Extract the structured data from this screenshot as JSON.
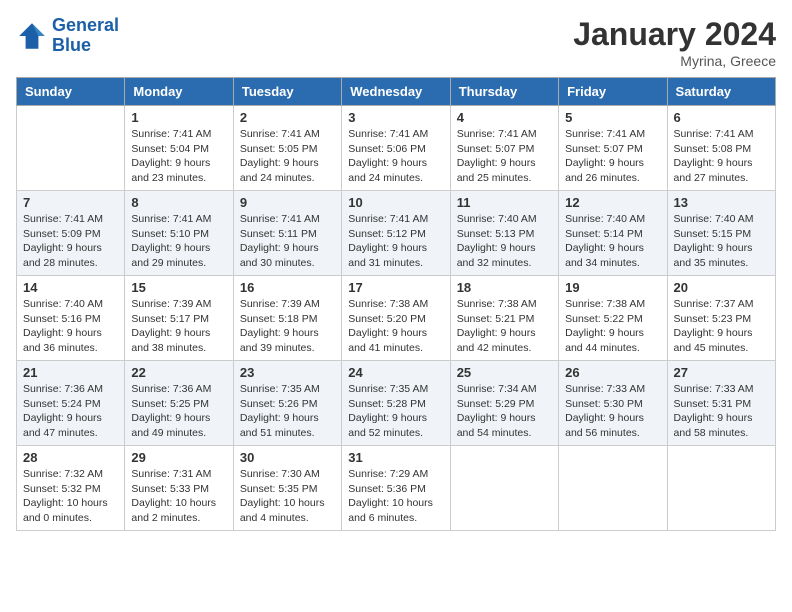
{
  "header": {
    "logo_line1": "General",
    "logo_line2": "Blue",
    "month_year": "January 2024",
    "location": "Myrina, Greece"
  },
  "days_of_week": [
    "Sunday",
    "Monday",
    "Tuesday",
    "Wednesday",
    "Thursday",
    "Friday",
    "Saturday"
  ],
  "weeks": [
    [
      {
        "day": "",
        "sunrise": "",
        "sunset": "",
        "daylight": ""
      },
      {
        "day": "1",
        "sunrise": "Sunrise: 7:41 AM",
        "sunset": "Sunset: 5:04 PM",
        "daylight": "Daylight: 9 hours and 23 minutes."
      },
      {
        "day": "2",
        "sunrise": "Sunrise: 7:41 AM",
        "sunset": "Sunset: 5:05 PM",
        "daylight": "Daylight: 9 hours and 24 minutes."
      },
      {
        "day": "3",
        "sunrise": "Sunrise: 7:41 AM",
        "sunset": "Sunset: 5:06 PM",
        "daylight": "Daylight: 9 hours and 24 minutes."
      },
      {
        "day": "4",
        "sunrise": "Sunrise: 7:41 AM",
        "sunset": "Sunset: 5:07 PM",
        "daylight": "Daylight: 9 hours and 25 minutes."
      },
      {
        "day": "5",
        "sunrise": "Sunrise: 7:41 AM",
        "sunset": "Sunset: 5:07 PM",
        "daylight": "Daylight: 9 hours and 26 minutes."
      },
      {
        "day": "6",
        "sunrise": "Sunrise: 7:41 AM",
        "sunset": "Sunset: 5:08 PM",
        "daylight": "Daylight: 9 hours and 27 minutes."
      }
    ],
    [
      {
        "day": "7",
        "sunrise": "Sunrise: 7:41 AM",
        "sunset": "Sunset: 5:09 PM",
        "daylight": "Daylight: 9 hours and 28 minutes."
      },
      {
        "day": "8",
        "sunrise": "Sunrise: 7:41 AM",
        "sunset": "Sunset: 5:10 PM",
        "daylight": "Daylight: 9 hours and 29 minutes."
      },
      {
        "day": "9",
        "sunrise": "Sunrise: 7:41 AM",
        "sunset": "Sunset: 5:11 PM",
        "daylight": "Daylight: 9 hours and 30 minutes."
      },
      {
        "day": "10",
        "sunrise": "Sunrise: 7:41 AM",
        "sunset": "Sunset: 5:12 PM",
        "daylight": "Daylight: 9 hours and 31 minutes."
      },
      {
        "day": "11",
        "sunrise": "Sunrise: 7:40 AM",
        "sunset": "Sunset: 5:13 PM",
        "daylight": "Daylight: 9 hours and 32 minutes."
      },
      {
        "day": "12",
        "sunrise": "Sunrise: 7:40 AM",
        "sunset": "Sunset: 5:14 PM",
        "daylight": "Daylight: 9 hours and 34 minutes."
      },
      {
        "day": "13",
        "sunrise": "Sunrise: 7:40 AM",
        "sunset": "Sunset: 5:15 PM",
        "daylight": "Daylight: 9 hours and 35 minutes."
      }
    ],
    [
      {
        "day": "14",
        "sunrise": "Sunrise: 7:40 AM",
        "sunset": "Sunset: 5:16 PM",
        "daylight": "Daylight: 9 hours and 36 minutes."
      },
      {
        "day": "15",
        "sunrise": "Sunrise: 7:39 AM",
        "sunset": "Sunset: 5:17 PM",
        "daylight": "Daylight: 9 hours and 38 minutes."
      },
      {
        "day": "16",
        "sunrise": "Sunrise: 7:39 AM",
        "sunset": "Sunset: 5:18 PM",
        "daylight": "Daylight: 9 hours and 39 minutes."
      },
      {
        "day": "17",
        "sunrise": "Sunrise: 7:38 AM",
        "sunset": "Sunset: 5:20 PM",
        "daylight": "Daylight: 9 hours and 41 minutes."
      },
      {
        "day": "18",
        "sunrise": "Sunrise: 7:38 AM",
        "sunset": "Sunset: 5:21 PM",
        "daylight": "Daylight: 9 hours and 42 minutes."
      },
      {
        "day": "19",
        "sunrise": "Sunrise: 7:38 AM",
        "sunset": "Sunset: 5:22 PM",
        "daylight": "Daylight: 9 hours and 44 minutes."
      },
      {
        "day": "20",
        "sunrise": "Sunrise: 7:37 AM",
        "sunset": "Sunset: 5:23 PM",
        "daylight": "Daylight: 9 hours and 45 minutes."
      }
    ],
    [
      {
        "day": "21",
        "sunrise": "Sunrise: 7:36 AM",
        "sunset": "Sunset: 5:24 PM",
        "daylight": "Daylight: 9 hours and 47 minutes."
      },
      {
        "day": "22",
        "sunrise": "Sunrise: 7:36 AM",
        "sunset": "Sunset: 5:25 PM",
        "daylight": "Daylight: 9 hours and 49 minutes."
      },
      {
        "day": "23",
        "sunrise": "Sunrise: 7:35 AM",
        "sunset": "Sunset: 5:26 PM",
        "daylight": "Daylight: 9 hours and 51 minutes."
      },
      {
        "day": "24",
        "sunrise": "Sunrise: 7:35 AM",
        "sunset": "Sunset: 5:28 PM",
        "daylight": "Daylight: 9 hours and 52 minutes."
      },
      {
        "day": "25",
        "sunrise": "Sunrise: 7:34 AM",
        "sunset": "Sunset: 5:29 PM",
        "daylight": "Daylight: 9 hours and 54 minutes."
      },
      {
        "day": "26",
        "sunrise": "Sunrise: 7:33 AM",
        "sunset": "Sunset: 5:30 PM",
        "daylight": "Daylight: 9 hours and 56 minutes."
      },
      {
        "day": "27",
        "sunrise": "Sunrise: 7:33 AM",
        "sunset": "Sunset: 5:31 PM",
        "daylight": "Daylight: 9 hours and 58 minutes."
      }
    ],
    [
      {
        "day": "28",
        "sunrise": "Sunrise: 7:32 AM",
        "sunset": "Sunset: 5:32 PM",
        "daylight": "Daylight: 10 hours and 0 minutes."
      },
      {
        "day": "29",
        "sunrise": "Sunrise: 7:31 AM",
        "sunset": "Sunset: 5:33 PM",
        "daylight": "Daylight: 10 hours and 2 minutes."
      },
      {
        "day": "30",
        "sunrise": "Sunrise: 7:30 AM",
        "sunset": "Sunset: 5:35 PM",
        "daylight": "Daylight: 10 hours and 4 minutes."
      },
      {
        "day": "31",
        "sunrise": "Sunrise: 7:29 AM",
        "sunset": "Sunset: 5:36 PM",
        "daylight": "Daylight: 10 hours and 6 minutes."
      },
      {
        "day": "",
        "sunrise": "",
        "sunset": "",
        "daylight": ""
      },
      {
        "day": "",
        "sunrise": "",
        "sunset": "",
        "daylight": ""
      },
      {
        "day": "",
        "sunrise": "",
        "sunset": "",
        "daylight": ""
      }
    ]
  ]
}
